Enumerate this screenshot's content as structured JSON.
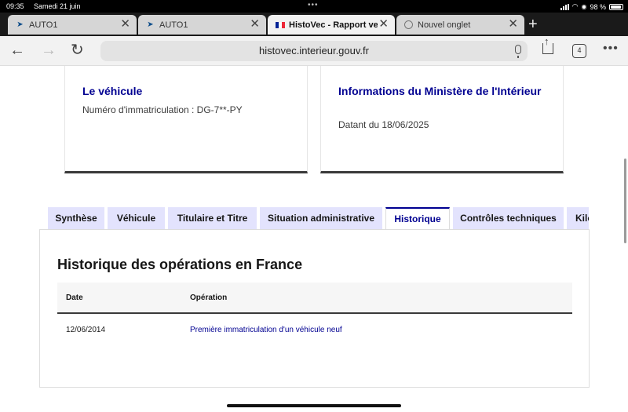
{
  "status_bar": {
    "time": "09:35",
    "date": "Samedi 21 juin",
    "battery": "98 %"
  },
  "browser_tabs": [
    {
      "title": "AUTO1",
      "favicon": "auto1-logo-icon",
      "active": false
    },
    {
      "title": "AUTO1",
      "favicon": "auto1-logo-icon",
      "active": false
    },
    {
      "title": "HistoVec - Rapport vendeur",
      "favicon": "french-flag-icon",
      "active": true
    },
    {
      "title": "Nouvel onglet",
      "favicon": "globe-icon",
      "active": false
    }
  ],
  "toolbar": {
    "url": "histovec.interieur.gouv.fr",
    "tab_count": "4"
  },
  "cards": {
    "vehicle": {
      "title": "Le véhicule",
      "line": "Numéro d'immatriculation : DG-7**-PY"
    },
    "ministry": {
      "title": "Informations du Ministère de l'Intérieur",
      "line": "Datant du 18/06/2025"
    }
  },
  "page_tabs": [
    {
      "label": "Synthèse",
      "active": false
    },
    {
      "label": "Véhicule",
      "active": false
    },
    {
      "label": "Titulaire et Titre",
      "active": false
    },
    {
      "label": "Situation administrative",
      "active": false
    },
    {
      "label": "Historique",
      "active": true
    },
    {
      "label": "Contrôles techniques",
      "active": false
    },
    {
      "label": "Kilométrage",
      "active": false
    }
  ],
  "history": {
    "heading": "Historique des opérations en France",
    "columns": {
      "date": "Date",
      "operation": "Opération"
    },
    "rows": [
      {
        "date": "12/06/2014",
        "operation": "Première immatriculation d'un véhicule neuf"
      }
    ]
  },
  "colors": {
    "accent": "#000091",
    "tab_bg": "#e3e3fd",
    "dark_border": "#3a3a3a"
  }
}
